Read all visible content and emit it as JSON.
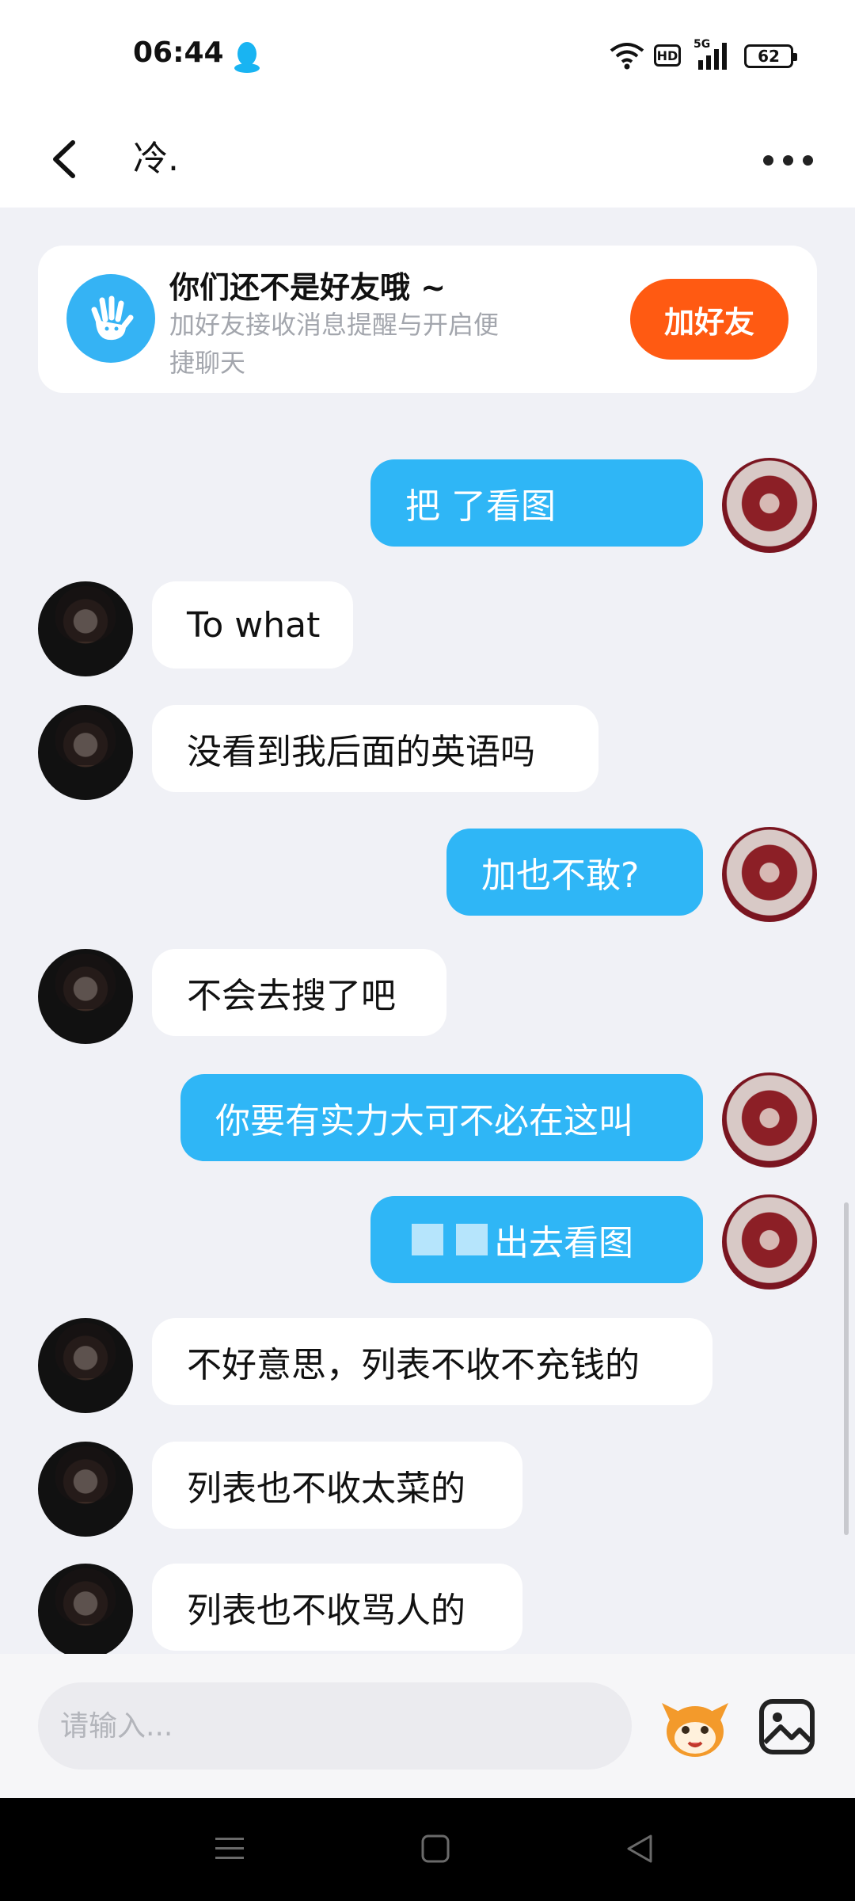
{
  "status_bar": {
    "time": "06:44",
    "hd_label": "HD",
    "network_label": "5G",
    "battery_level": "62"
  },
  "header": {
    "title": "冷."
  },
  "friend_notice": {
    "title": "你们还不是好友哦 ~",
    "description": "加好友接收消息提醒与开启便捷聊天",
    "button_label": "加好友"
  },
  "messages": [
    {
      "sender": "self",
      "text": "把 了看图"
    },
    {
      "sender": "other",
      "text": "To what"
    },
    {
      "sender": "other",
      "text": "没看到我后面的英语吗"
    },
    {
      "sender": "self",
      "text": "加也不敢?"
    },
    {
      "sender": "other",
      "text": "不会去搜了吧"
    },
    {
      "sender": "self",
      "text": "你要有实力大可不必在这叫"
    },
    {
      "sender": "self",
      "text": "出去看图"
    },
    {
      "sender": "other",
      "text": "不好意思，列表不收不充钱的"
    },
    {
      "sender": "other",
      "text": "列表也不收太菜的"
    },
    {
      "sender": "other",
      "text": "列表也不收骂人的"
    }
  ],
  "input": {
    "placeholder": "请输入...",
    "value": ""
  },
  "colors": {
    "self_bubble": "#2fb6f6",
    "add_friend_button": "#ff5a12",
    "background": "#f0f1f6"
  },
  "icons": {
    "status": [
      "qq-penguin-icon",
      "wifi-icon",
      "signal-icon",
      "battery-icon"
    ],
    "header": [
      "back-arrow-icon",
      "more-dots-icon"
    ],
    "input": [
      "emoji-mascot-icon",
      "image-icon"
    ],
    "nav": [
      "menu-icon",
      "home-icon",
      "back-triangle-icon"
    ]
  }
}
